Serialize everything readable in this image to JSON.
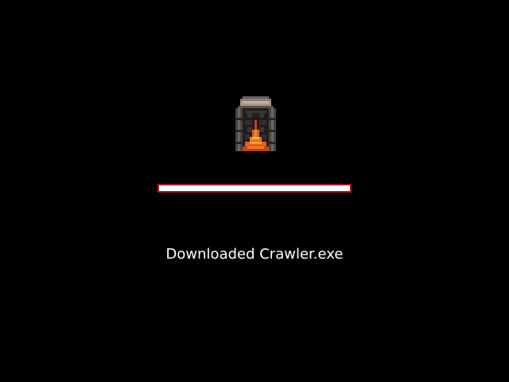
{
  "window": {
    "background_color": "#000000"
  },
  "loader": {
    "icon": "lava-furnace-icon"
  },
  "progress": {
    "value_percent": 100,
    "track_color": "#b0141e",
    "fill_color": "#ffffff"
  },
  "status": {
    "text": "Downloaded Crawler.exe"
  }
}
